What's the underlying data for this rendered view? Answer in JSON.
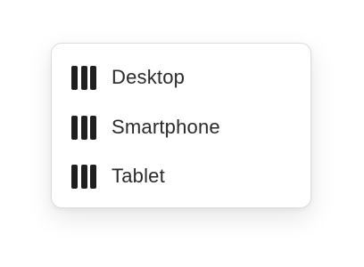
{
  "menu": {
    "items": [
      {
        "label": "Desktop",
        "icon": "columns-icon"
      },
      {
        "label": "Smartphone",
        "icon": "columns-icon"
      },
      {
        "label": "Tablet",
        "icon": "columns-icon"
      }
    ]
  },
  "colors": {
    "icon": "#1f1f1f",
    "text": "#2a2a2a",
    "border": "#dcdcdc",
    "background": "#ffffff"
  }
}
